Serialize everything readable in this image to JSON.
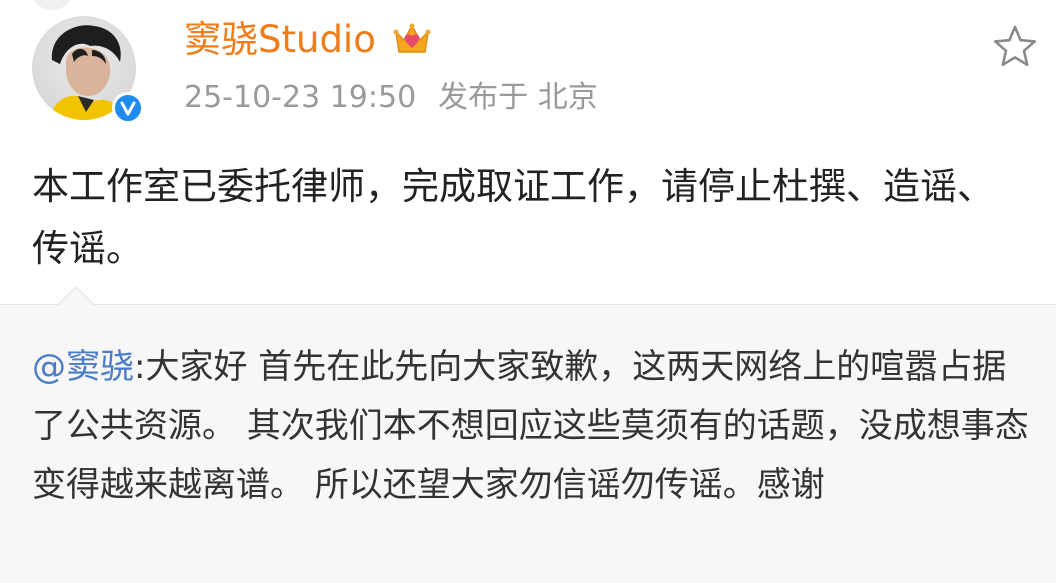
{
  "post": {
    "author": "窦骁Studio",
    "timestamp": "25-10-23 19:50",
    "location": "发布于 北京",
    "text": "本工作室已委托律师，完成取证工作，请停止杜撰、造谣、传谣。"
  },
  "quoted": {
    "mention": "@窦骁",
    "text": ":大家好 首先在此先向大家致歉，这两天网络上的喧嚣占据了公共资源。 其次我们本不想回应这些莫须有的话题，没成想事态变得越来越离谱。 所以还望大家勿信谣勿传谣。感谢"
  },
  "icons": {
    "verified": "verified-badge-icon",
    "crown": "crown-icon",
    "favorite": "star-icon"
  },
  "colors": {
    "username": "#f07c1a",
    "mention": "#4a7cc7",
    "verified": "#1e8bf0",
    "meta": "#9a9a9a"
  }
}
